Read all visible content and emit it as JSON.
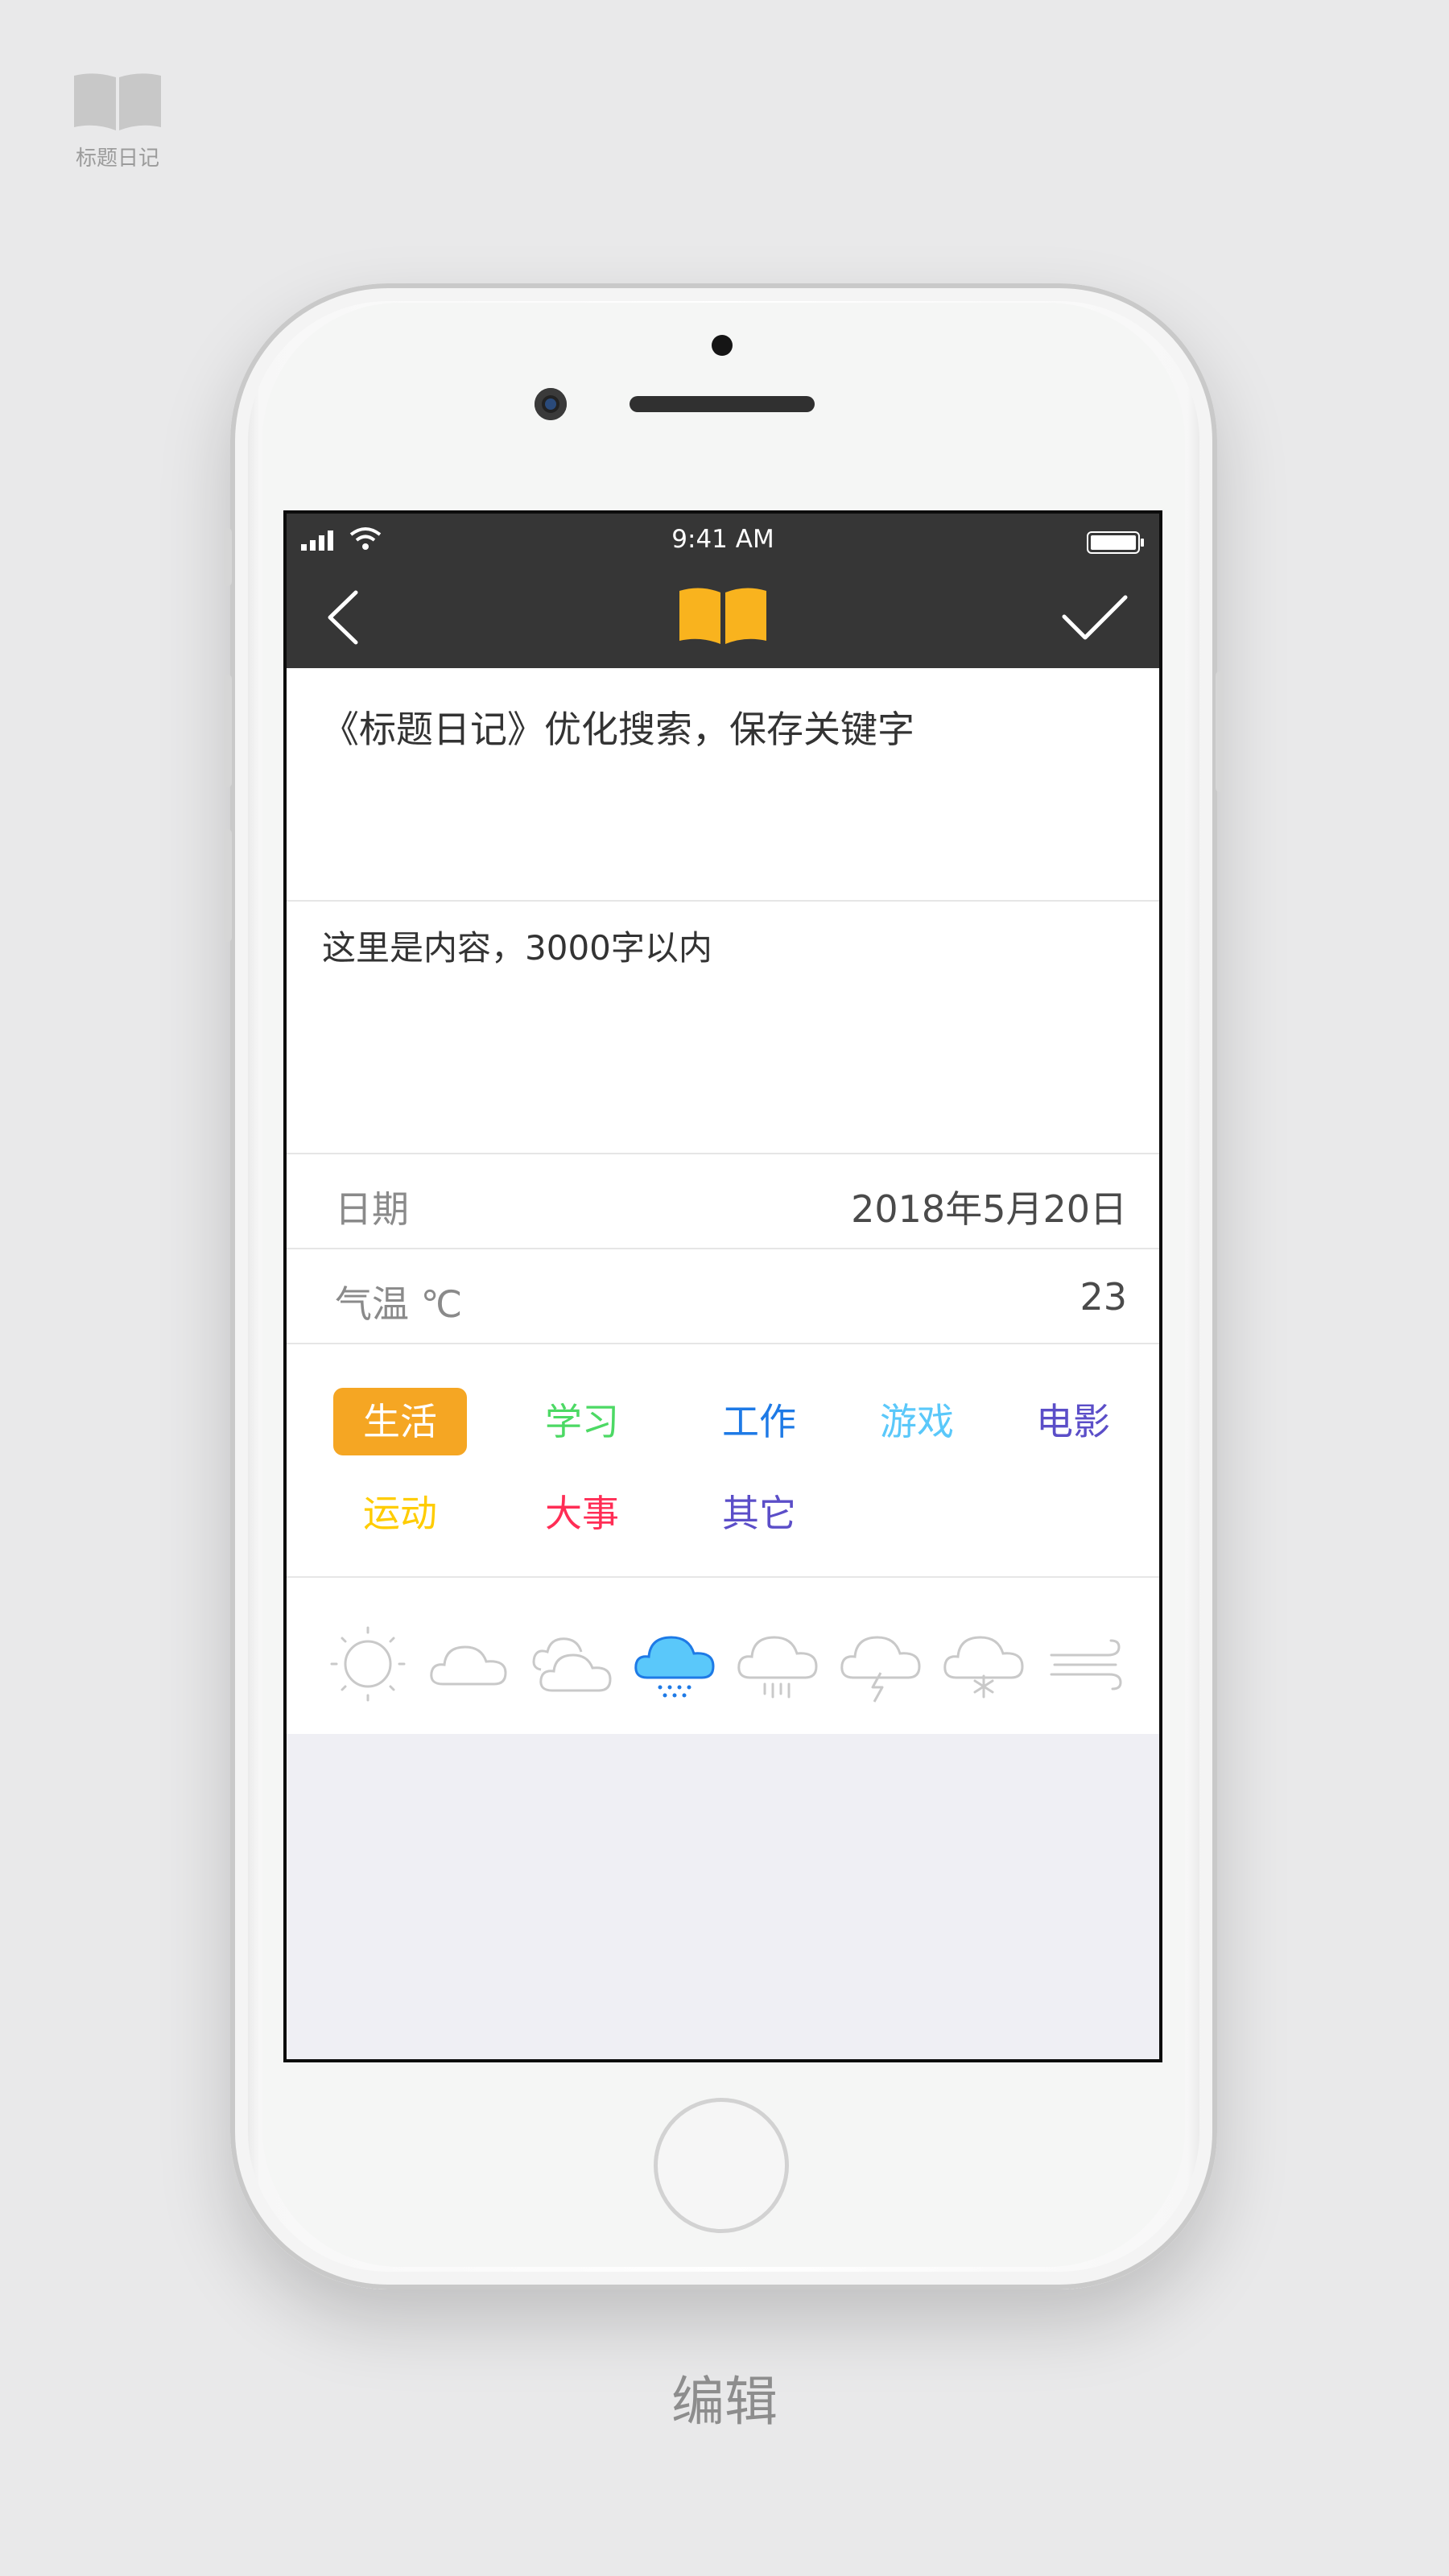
{
  "brand": {
    "label": "标题日记",
    "icon": "book-icon",
    "color": "#c8c8c8"
  },
  "status_bar": {
    "time": "9:41 AM",
    "signal_icon": "cellular-signal-icon",
    "wifi_icon": "wifi-icon",
    "battery_icon": "battery-icon"
  },
  "nav": {
    "back_icon": "chevron-left-icon",
    "logo_icon": "open-book-icon",
    "done_icon": "checkmark-icon",
    "background": "#363636",
    "logo_color": "#f9b31e"
  },
  "entry": {
    "title": "《标题日记》优化搜索，保存关键字",
    "content": "这里是内容，3000字以内"
  },
  "fields": {
    "date_label": "日期",
    "date_value": "2018年5月20日",
    "temperature_label": "气温 ℃",
    "temperature_value": "23"
  },
  "categories": [
    {
      "label": "生活",
      "color": "#f5a623",
      "selected": true
    },
    {
      "label": "学习",
      "color": "#4cd964",
      "selected": false
    },
    {
      "label": "工作",
      "color": "#1e7ae6",
      "selected": false
    },
    {
      "label": "游戏",
      "color": "#5ac8fa",
      "selected": false
    },
    {
      "label": "电影",
      "color": "#5b4ec8",
      "selected": false
    },
    {
      "label": "运动",
      "color": "#ffcc00",
      "selected": false
    },
    {
      "label": "大事",
      "color": "#ff2d55",
      "selected": false
    },
    {
      "label": "其它",
      "color": "#5b4ec8",
      "selected": false
    }
  ],
  "weather": [
    {
      "name": "sunny-icon",
      "selected": false
    },
    {
      "name": "cloudy-icon",
      "selected": false
    },
    {
      "name": "overcast-icon",
      "selected": false
    },
    {
      "name": "light-rain-icon",
      "selected": true
    },
    {
      "name": "heavy-rain-icon",
      "selected": false
    },
    {
      "name": "thunderstorm-icon",
      "selected": false
    },
    {
      "name": "snow-icon",
      "selected": false
    },
    {
      "name": "wind-icon",
      "selected": false
    }
  ],
  "weather_selected_color": "#5ac8fa",
  "caption": "编辑"
}
